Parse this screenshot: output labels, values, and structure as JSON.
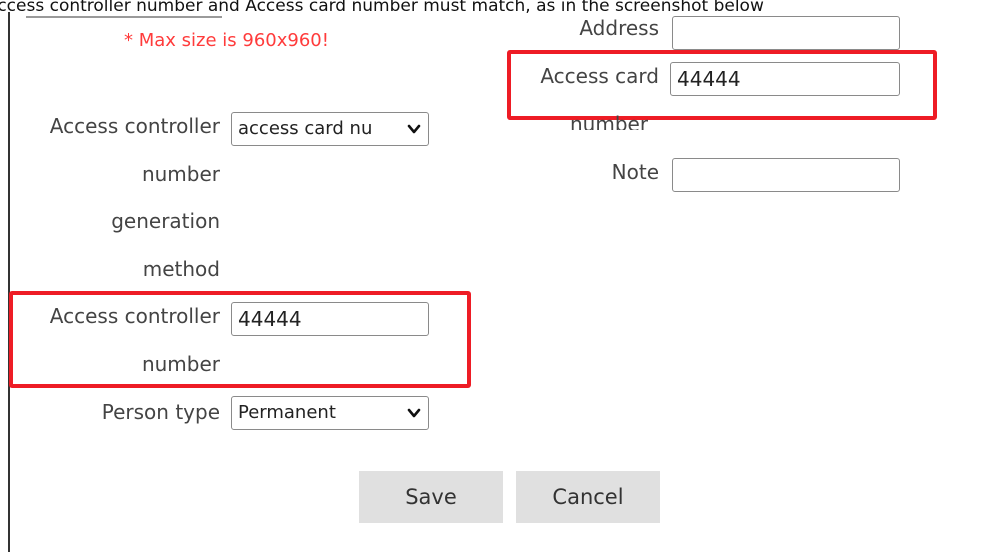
{
  "caption": "Access controller number and Access card number must match, as in the screenshot below",
  "upload": {
    "warning": "* Max size is 960x960!"
  },
  "form": {
    "address": {
      "label": "Address",
      "value": ""
    },
    "access_card": {
      "label_line1": "Access card",
      "label_line2": "number",
      "value": "44444"
    },
    "note": {
      "label": "Note",
      "value": ""
    },
    "generation_method": {
      "label_lines": [
        "Access controller",
        "number",
        "generation",
        "method"
      ],
      "selected": "access card nu"
    },
    "access_controller": {
      "label_line1": "Access controller",
      "label_line2": "number",
      "value": "44444"
    },
    "person_type": {
      "label": "Person type",
      "selected": "Permanent"
    }
  },
  "buttons": {
    "save": "Save",
    "cancel": "Cancel"
  },
  "colors": {
    "highlight": "#ee1c25",
    "warning": "#ff3b3b",
    "button_bg": "#e0e0e0"
  },
  "icons": {
    "dropdown": "chevron-down-icon"
  }
}
